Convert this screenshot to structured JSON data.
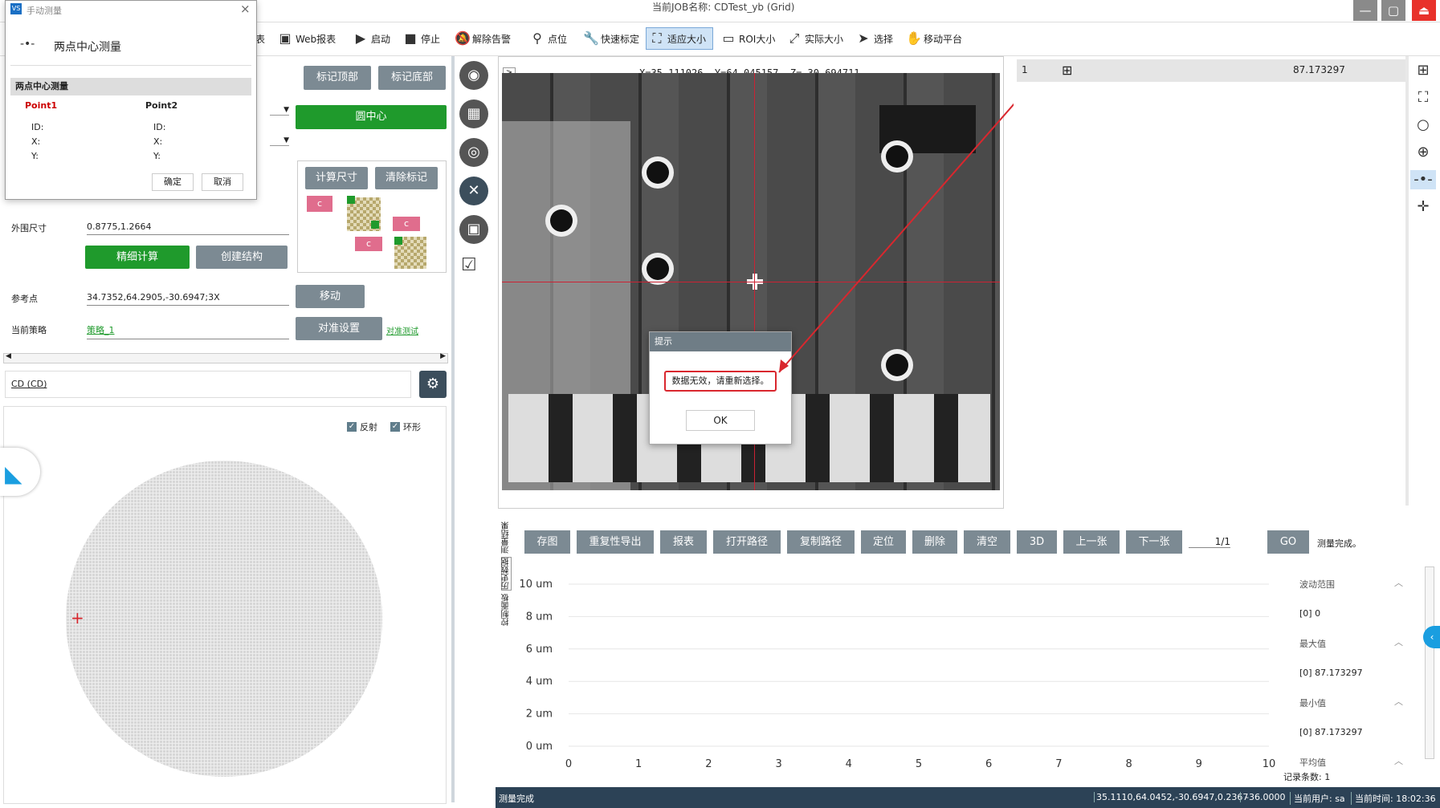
{
  "window": {
    "job_title": "当前JOB名称: CDTest_yb (Grid)",
    "minimize": "—",
    "maximize": "▢",
    "exit": "⏏"
  },
  "toolbar": {
    "items": [
      {
        "label": "表",
        "icon": "table-icon"
      },
      {
        "label": "Web报表",
        "icon": "web-report-icon"
      },
      {
        "label": "启动",
        "icon": "play-icon"
      },
      {
        "label": "停止",
        "icon": "stop-icon"
      },
      {
        "label": "解除告警",
        "icon": "bell-off-icon"
      },
      {
        "label": "点位",
        "icon": "pin-icon"
      },
      {
        "label": "快速标定",
        "icon": "wrench-icon"
      },
      {
        "label": "适应大小",
        "icon": "fit-icon"
      },
      {
        "label": "ROI大小",
        "icon": "roi-icon"
      },
      {
        "label": "实际大小",
        "icon": "expand-icon"
      },
      {
        "label": "选择",
        "icon": "cursor-icon"
      },
      {
        "label": "移动平台",
        "icon": "hand-icon"
      }
    ]
  },
  "dialog": {
    "title": "手动测量",
    "close": "×",
    "heading": "两点中心测量",
    "section": "两点中心测量",
    "point1": "Point1",
    "point2": "Point2",
    "id_label": "ID:",
    "x_label": "X:",
    "y_label": "Y:",
    "ok": "确定",
    "cancel": "取消"
  },
  "left": {
    "mark_top": "标记顶部",
    "mark_bottom": "标记底部",
    "circle_center": "圆中心",
    "calc_size": "计算尺寸",
    "clear_mark": "清除标记",
    "c_label": "c",
    "outer_size_label": "外围尺寸",
    "outer_size_value": "0.8775,1.2664",
    "fine_calc": "精细计算",
    "create_struct": "创建结构",
    "ref_point_label": "参考点",
    "ref_point_value": "34.7352,64.2905,-30.6947;3X",
    "move": "移动",
    "strategy_label": "当前策略",
    "strategy_value": "策略_1",
    "align_settings": "对准设置",
    "align_test": "对准测试",
    "cd_tab": "CD (CD)",
    "reflect": "反射",
    "ring": "环形"
  },
  "viewer": {
    "coords": "X=35.111026, Y=64.045157, Z=-30.694711",
    "collapse": ">"
  },
  "alert": {
    "title": "提示",
    "message": "数据无效，请重新选择。",
    "ok": "OK"
  },
  "results": {
    "index": "1",
    "value": "87.173297"
  },
  "bottom": {
    "buttons": [
      "存图",
      "重复性导出",
      "报表",
      "打开路径",
      "复制路径",
      "定位",
      "删除",
      "清空",
      "3D",
      "上一张",
      "下一张"
    ],
    "page": "1/1",
    "go": "GO",
    "status": "测量完成。",
    "vtabs": [
      "测量结果",
      "历史数据",
      "控制面板"
    ]
  },
  "chart_data": {
    "type": "line",
    "x_ticks": [
      "0",
      "1",
      "2",
      "3",
      "4",
      "5",
      "6",
      "7",
      "8",
      "9",
      "10"
    ],
    "y_ticks": [
      "0 um",
      "2 um",
      "4 um",
      "6 um",
      "8 um",
      "10 um"
    ],
    "xlim": [
      0,
      10
    ],
    "ylim": [
      0,
      10
    ],
    "series": []
  },
  "stats": {
    "range_label": "波动范围",
    "range_value": "[0]  0",
    "max_label": "最大值",
    "max_value": "[0]  87.173297",
    "min_label": "最小值",
    "min_value": "[0]  87.173297",
    "avg_label": "平均值",
    "count": "记录条数: 1"
  },
  "statusbar": {
    "left": "测量完成",
    "coords": "35.1110,64.0452,-30.6947,0.2367",
    "angle": "-36.0000",
    "user": "当前用户: sa",
    "time": "当前时间: 18:02:36"
  },
  "colors": {
    "accent_green": "#1f9a2c",
    "button_gray": "#7c8a93",
    "status_bg": "#2c4256",
    "alert_red": "#d9272e"
  }
}
